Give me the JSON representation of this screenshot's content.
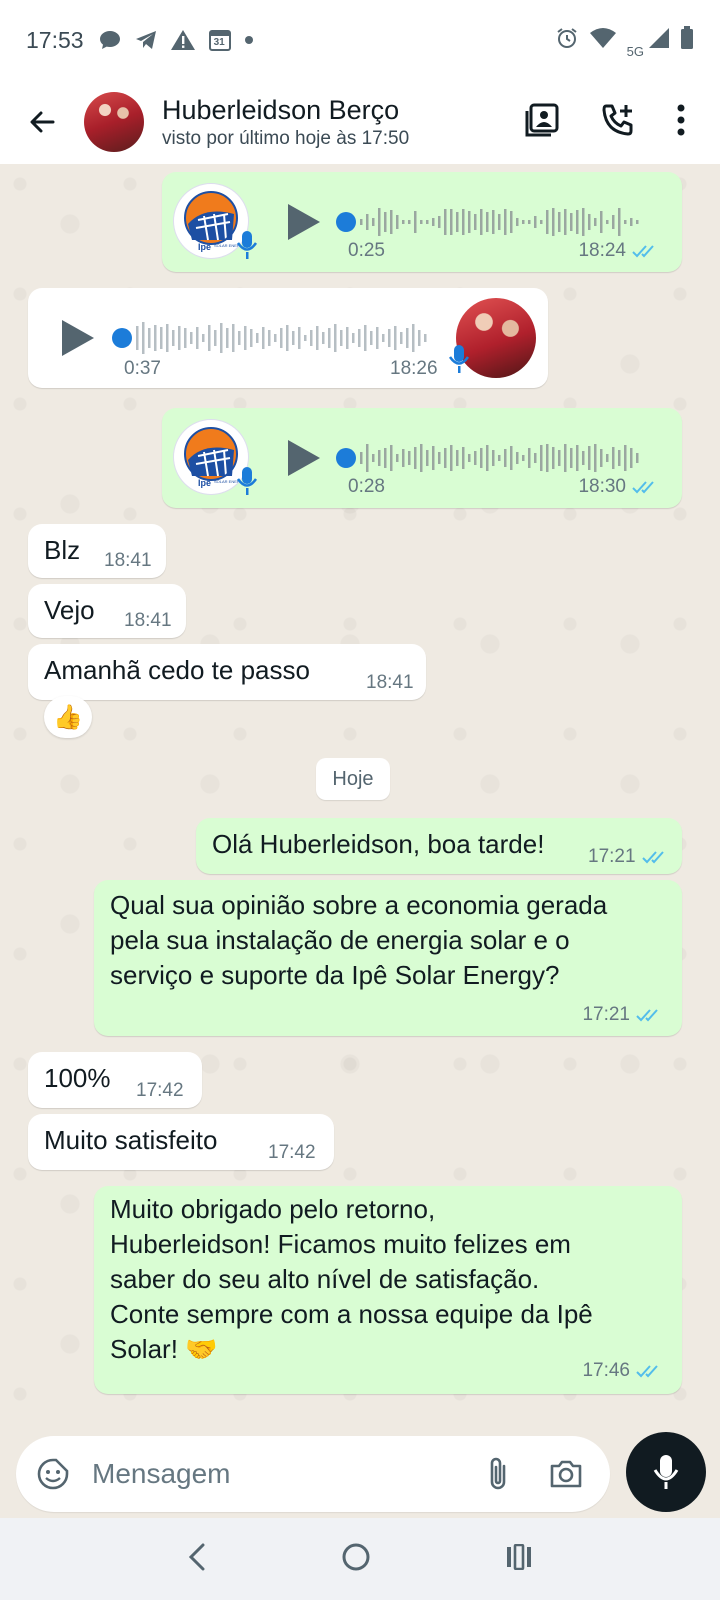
{
  "status_bar": {
    "time": "17:53",
    "calendar_day": "31",
    "network": "5G",
    "left_icons": [
      "chat-bubble-icon",
      "telegram-icon",
      "warning-icon",
      "calendar-icon",
      "dot-icon"
    ],
    "right_icons": [
      "alarm-icon",
      "wifi-icon",
      "signal-icon",
      "battery-icon"
    ]
  },
  "header": {
    "contact_name": "Huberleidson Berço",
    "last_seen": "visto por último hoje às 17:50",
    "icons": [
      "back-arrow-icon",
      "contact-card-icon",
      "add-call-icon",
      "more-vert-icon"
    ]
  },
  "messages": {
    "voice1": {
      "duration": "0:25",
      "time": "18:24",
      "direction": "out"
    },
    "voice2": {
      "duration": "0:37",
      "time": "18:26",
      "direction": "in"
    },
    "voice3": {
      "duration": "0:28",
      "time": "18:30",
      "direction": "out"
    },
    "m1": {
      "text": "Blz",
      "time": "18:41"
    },
    "m2": {
      "text": "Vejo",
      "time": "18:41"
    },
    "m3": {
      "text": "Amanhã cedo te passo",
      "time": "18:41",
      "reaction": "👍"
    },
    "date_divider": "Hoje",
    "m4": {
      "text": "Olá Huberleidson, boa tarde!",
      "time": "17:21"
    },
    "m5": {
      "line1": "Qual sua opinião sobre a economia gerada",
      "line2": "pela sua instalação de energia solar e o",
      "line3": "serviço e suporte da Ipê Solar Energy?",
      "time": "17:21"
    },
    "m6": {
      "text": "100%",
      "time": "17:42"
    },
    "m7": {
      "text": "Muito satisfeito",
      "time": "17:42"
    },
    "m8": {
      "line1": "Muito obrigado pelo retorno,",
      "line2": "Huberleidson! Ficamos muito felizes em",
      "line3": "saber do seu alto nível de satisfação.",
      "line4": "Conte sempre com a nossa equipe da Ipê",
      "line5": "Solar! 🤝",
      "time": "17:46"
    }
  },
  "logo": {
    "text": "Ipê",
    "small_text": "SOLAR ENERGY"
  },
  "composer": {
    "placeholder": "Mensagem"
  },
  "colors": {
    "outgoing_bubble": "#d9fdd3",
    "incoming_bubble": "#ffffff",
    "read_ticks": "#53bdeb",
    "wallpaper": "#efeae2",
    "mic_button": "#111b21"
  }
}
